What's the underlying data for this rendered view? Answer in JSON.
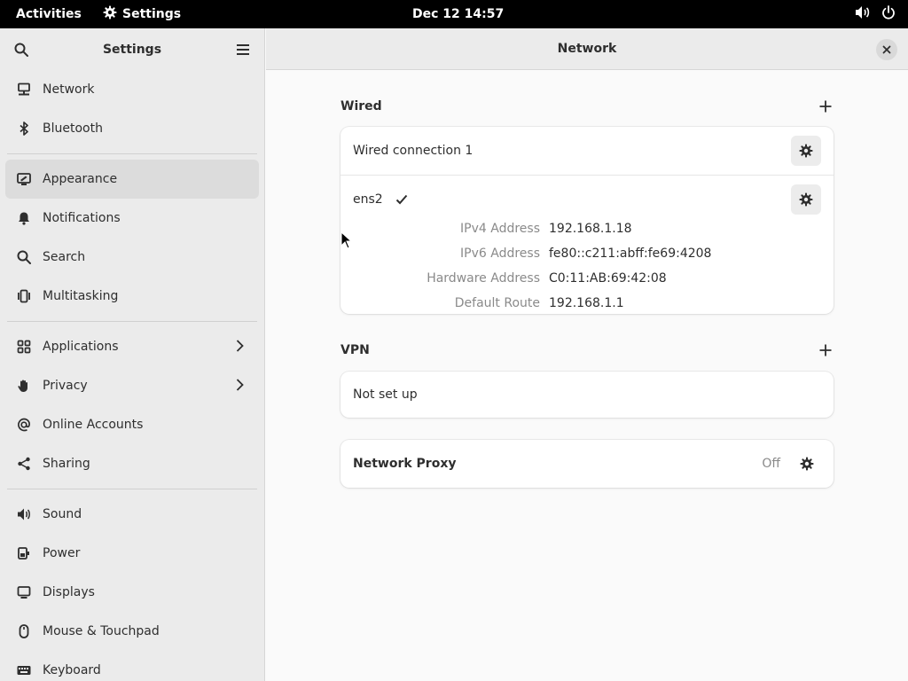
{
  "topbar": {
    "activities": "Activities",
    "app_name": "Settings",
    "clock": "Dec 12  14:57"
  },
  "sidebar": {
    "title": "Settings",
    "groups": [
      [
        {
          "label": "Network",
          "icon": "network-icon"
        },
        {
          "label": "Bluetooth",
          "icon": "bluetooth-icon"
        }
      ],
      [
        {
          "label": "Appearance",
          "icon": "appearance-icon",
          "active": true
        },
        {
          "label": "Notifications",
          "icon": "bell-icon"
        },
        {
          "label": "Search",
          "icon": "search-icon"
        },
        {
          "label": "Multitasking",
          "icon": "multitasking-icon"
        }
      ],
      [
        {
          "label": "Applications",
          "icon": "apps-grid-icon",
          "chevron": true
        },
        {
          "label": "Privacy",
          "icon": "hand-icon",
          "chevron": true
        },
        {
          "label": "Online Accounts",
          "icon": "at-icon"
        },
        {
          "label": "Sharing",
          "icon": "share-icon"
        }
      ],
      [
        {
          "label": "Sound",
          "icon": "speaker-icon"
        },
        {
          "label": "Power",
          "icon": "power-plug-icon"
        },
        {
          "label": "Displays",
          "icon": "display-icon"
        },
        {
          "label": "Mouse & Touchpad",
          "icon": "mouse-icon"
        },
        {
          "label": "Keyboard",
          "icon": "keyboard-icon"
        }
      ]
    ]
  },
  "main": {
    "title": "Network",
    "wired": {
      "heading": "Wired",
      "connection_name": "Wired connection 1",
      "device": "ens2",
      "details": [
        {
          "key": "IPv4 Address",
          "value": "192.168.1.18"
        },
        {
          "key": "IPv6 Address",
          "value": "fe80::c211:abff:fe69:4208"
        },
        {
          "key": "Hardware Address",
          "value": "C0:11:AB:69:42:08"
        },
        {
          "key": "Default Route",
          "value": "192.168.1.1"
        }
      ]
    },
    "vpn": {
      "heading": "VPN",
      "status": "Not set up"
    },
    "proxy": {
      "label": "Network Proxy",
      "status": "Off"
    }
  }
}
